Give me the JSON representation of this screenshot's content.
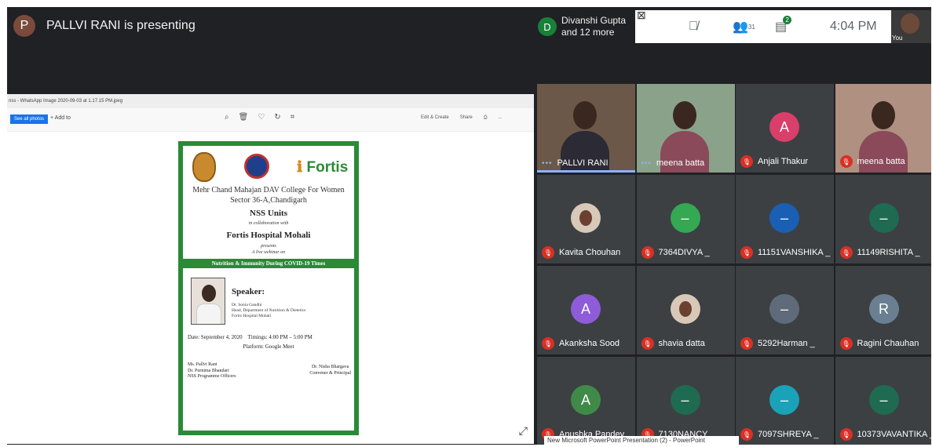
{
  "presenter": {
    "avatar_letter": "P",
    "text": "PALLVI RANI is presenting"
  },
  "join": {
    "avatar_letter": "D",
    "line1": "Divanshi Gupta",
    "line2": "and 12 more"
  },
  "toolbar": {
    "people_count": "31",
    "chat_count": "2",
    "time": "4:04 PM",
    "self_label": "You"
  },
  "shared_window": {
    "file_title": "nss - WhatsApp Image 2020-09-03 at 1.17.15 PM.jpeg",
    "see_all": "See all photos",
    "add_to": "+ Add to",
    "edit_create": "Edit & Create",
    "share": "Share",
    "more": "..."
  },
  "poster": {
    "logo_text": "Fortis",
    "college": "Mehr Chand Mahajan DAV College For Women Sector 36-A,Chandigarh",
    "units": "NSS Units",
    "collab": "in collaboration with",
    "hospital": "Fortis Hospital Mohali",
    "presents": "presents",
    "webinar": "A live webinar on",
    "band": "Nutrition & Immunity During COVID-19 Times",
    "speaker_heading": "Speaker:",
    "speaker_name": "Dr. Sonia Gandhi",
    "speaker_role": "Head, Department of Nutrition & Dietetics",
    "speaker_org": "Fortis Hospital Mohali",
    "date": "Date: September 4, 2020",
    "timings": "Timings: 4:00 PM – 5:00 PM",
    "platform": "Platform: Google Meet",
    "officer1": "Ms. Pallvi Rani",
    "officer2": "Dr. Purnima Bhandari",
    "officer_role": "NSS Programme Officers",
    "convener_name": "Dr. Nisha Bhargava",
    "convener_role": "Convener & Principal"
  },
  "participants": [
    {
      "name": "PALLVI RANI",
      "type": "video",
      "muted": false,
      "speaking": true
    },
    {
      "name": "meena batta",
      "type": "video",
      "muted": false,
      "speaking": false
    },
    {
      "name": "Anjali Thakur",
      "type": "letter",
      "letter": "A",
      "color": "#d93f6a",
      "muted": true
    },
    {
      "name": "meena batta",
      "type": "video",
      "muted": true
    },
    {
      "name": "Kavita Chouhan",
      "type": "photo",
      "muted": true
    },
    {
      "name": "7364DIVYA _",
      "type": "letter",
      "letter": "–",
      "color": "#34a853",
      "muted": true
    },
    {
      "name": "11151VANSHIKA _",
      "type": "letter",
      "letter": "–",
      "color": "#1a5fb4",
      "muted": true
    },
    {
      "name": "11149RISHITA _",
      "type": "letter",
      "letter": "–",
      "color": "#1e6b52",
      "muted": true
    },
    {
      "name": "Akanksha Sood",
      "type": "letter",
      "letter": "A",
      "color": "#8e5cd9",
      "muted": true
    },
    {
      "name": "shavia datta",
      "type": "photo",
      "muted": true
    },
    {
      "name": "5292Harman _",
      "type": "letter",
      "letter": "–",
      "color": "#5f6b7a",
      "muted": true
    },
    {
      "name": "Ragini Chauhan",
      "type": "letter",
      "letter": "R",
      "color": "#6b7f92",
      "muted": true
    },
    {
      "name": "Anushka Pandey",
      "type": "letter",
      "letter": "A",
      "color": "#3f8a48",
      "muted": true
    },
    {
      "name": "7130NANCY _",
      "type": "letter",
      "letter": "–",
      "color": "#1e6b52",
      "muted": true
    },
    {
      "name": "7097SHREYA _",
      "type": "letter",
      "letter": "–",
      "color": "#1aa3b8",
      "muted": true
    },
    {
      "name": "10373VAVANTIKA _",
      "type": "letter",
      "letter": "–",
      "color": "#1e6b52",
      "muted": true
    }
  ],
  "tooltip": "New Microsoft PowerPoint Presentation (2) - PowerPoint"
}
